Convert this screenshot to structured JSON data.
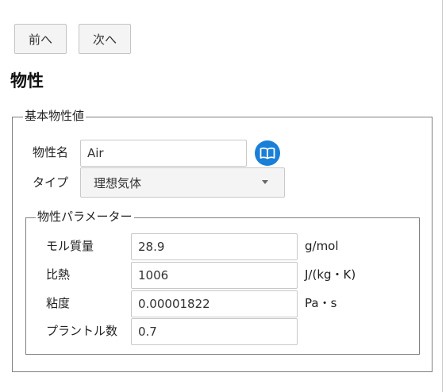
{
  "nav": {
    "prev_label": "前へ",
    "next_label": "次へ"
  },
  "page": {
    "title": "物性"
  },
  "basic": {
    "legend": "基本物性値",
    "name_label": "物性名",
    "name_value": "Air",
    "type_label": "タイプ",
    "type_value": "理想気体",
    "book_icon": "book-icon"
  },
  "params": {
    "legend": "物性パラメーター",
    "rows": [
      {
        "label": "モル質量",
        "value": "28.9",
        "unit": "g/mol"
      },
      {
        "label": "比熱",
        "value": "1006",
        "unit": "J/(kg・K)"
      },
      {
        "label": "粘度",
        "value": "0.00001822",
        "unit": "Pa・s"
      },
      {
        "label": "プラントル数",
        "value": "0.7",
        "unit": ""
      }
    ]
  },
  "colors": {
    "accent": "#1a7fd8",
    "border": "#7f7f7f"
  }
}
